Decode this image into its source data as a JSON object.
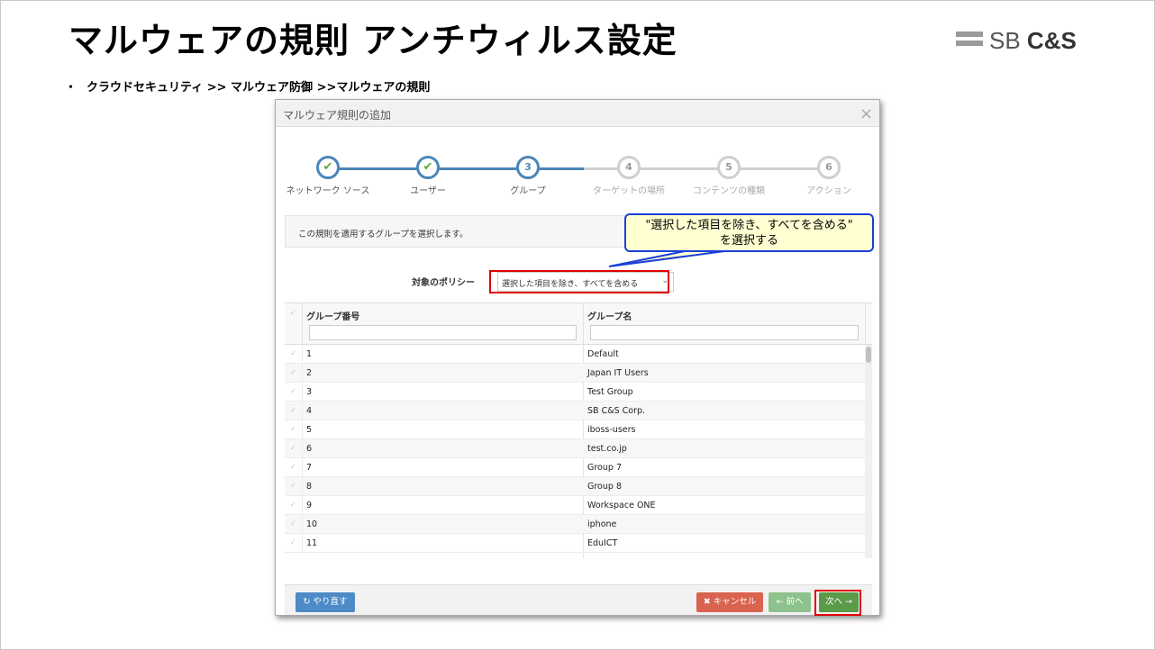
{
  "slide": {
    "title": "マルウェアの規則 アンチウィルス設定",
    "logo_sb": "SB",
    "logo_cs": "C&S",
    "bullet": "・",
    "breadcrumb": "クラウドセキュリティ >> マルウェア防御 >>マルウェアの規則"
  },
  "dialog": {
    "title": "マルウェア規則の追加",
    "close": "×",
    "steps": [
      {
        "number": "✔",
        "label": "ネットワーク ソース",
        "state": "done"
      },
      {
        "number": "✔",
        "label": "ユーザー",
        "state": "done"
      },
      {
        "number": "3",
        "label": "グループ",
        "state": "current"
      },
      {
        "number": "4",
        "label": "ターゲットの場所",
        "state": "todo"
      },
      {
        "number": "5",
        "label": "コンテンツの種類",
        "state": "todo"
      },
      {
        "number": "6",
        "label": "アクション",
        "state": "todo"
      }
    ],
    "info": "この規則を適用するグループを選択します。",
    "policy_label": "対象のポリシー",
    "policy_value": "選択した項目を除き、すべてを含める",
    "table": {
      "check_symbol": "✓",
      "col_num": "グループ番号",
      "col_name": "グループ名",
      "rows": [
        {
          "num": "1",
          "name": "Default"
        },
        {
          "num": "2",
          "name": "Japan IT Users"
        },
        {
          "num": "3",
          "name": "Test Group"
        },
        {
          "num": "4",
          "name": "SB C&S Corp."
        },
        {
          "num": "5",
          "name": "iboss-users"
        },
        {
          "num": "6",
          "name": "test.co.jp"
        },
        {
          "num": "7",
          "name": "Group 7"
        },
        {
          "num": "8",
          "name": "Group 8"
        },
        {
          "num": "9",
          "name": "Workspace ONE"
        },
        {
          "num": "10",
          "name": "iphone"
        },
        {
          "num": "11",
          "name": "EduICT"
        }
      ]
    },
    "buttons": {
      "redo": "↻ やり直す",
      "cancel": "✖ キャンセル",
      "prev": "← 前へ",
      "next": "次へ →"
    }
  },
  "annotation": {
    "line1": "\"選択した項目を除き、すべてを含める\"",
    "line2": "を選択する"
  },
  "colors": {
    "accent": "#4a86b8",
    "highlight": "#e00000",
    "callout_border": "#1a3fd6"
  }
}
